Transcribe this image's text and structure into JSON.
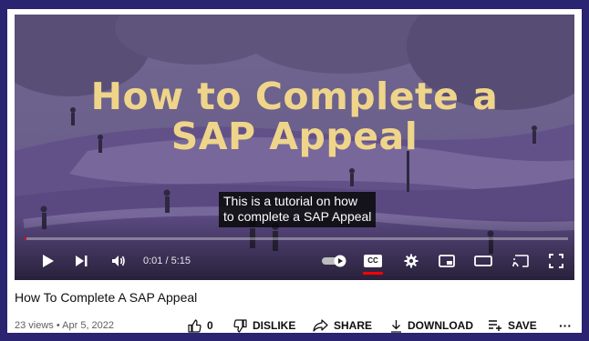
{
  "video": {
    "overlay_title_line1": "How to Complete a",
    "overlay_title_line2": "SAP Appeal",
    "caption_line1": "This is a tutorial on how",
    "caption_line2": "to complete a SAP Appeal",
    "time": "0:01 / 5:15",
    "progress_fraction": 0.003,
    "accent_color": "#ff0000",
    "title_color": "#efd58a"
  },
  "controls": {
    "play_icon": "play-icon",
    "next_icon": "next-icon",
    "volume_icon": "volume-icon",
    "autoplay_icon": "autoplay-toggle-icon",
    "cc_label": "CC",
    "settings_icon": "gear-icon",
    "miniplayer_icon": "miniplayer-icon",
    "theater_icon": "theater-mode-icon",
    "cast_icon": "cast-icon",
    "fullscreen_icon": "fullscreen-icon"
  },
  "info": {
    "title": "How To Complete A SAP Appeal",
    "meta": "23 views • Apr 5, 2022"
  },
  "actions": {
    "like_count": "0",
    "dislike_label": "DISLIKE",
    "share_label": "SHARE",
    "download_label": "DOWNLOAD",
    "save_label": "SAVE",
    "more_label": "···"
  },
  "colors": {
    "page_background": "#2b2470",
    "card_background": "#ffffff"
  }
}
